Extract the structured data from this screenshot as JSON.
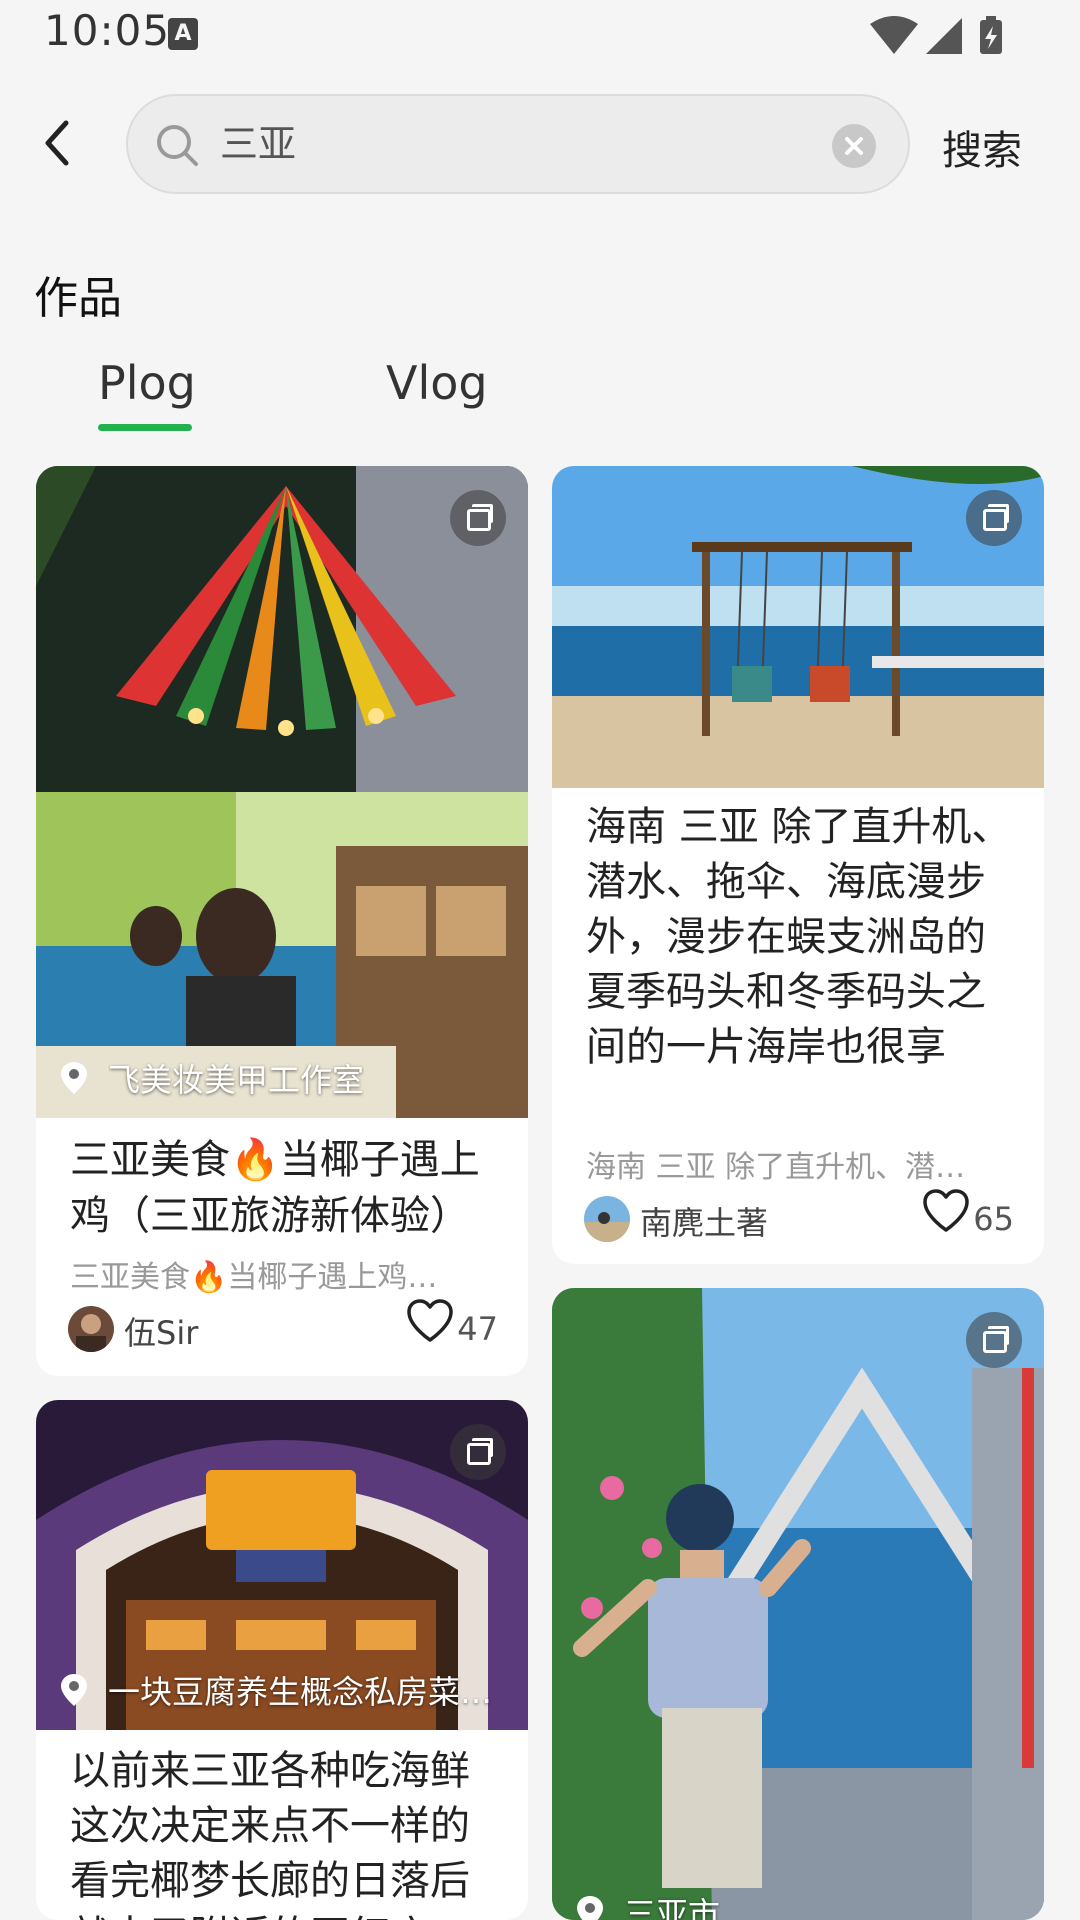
{
  "status": {
    "time": "10:05",
    "ime_badge": "A"
  },
  "search": {
    "query": "三亚",
    "button_label": "搜索"
  },
  "section": {
    "title": "作品"
  },
  "tabs": [
    {
      "label": "Plog",
      "selected": true
    },
    {
      "label": "Vlog",
      "selected": false
    }
  ],
  "cards": [
    {
      "location": "飞美妆美甲工作室",
      "title": "三亚美食🔥当椰子遇上鸡（三亚旅游新体验）",
      "subtitle": "三亚美食🔥当椰子遇上鸡…",
      "author": "伍Sir",
      "likes": "47"
    },
    {
      "title": "海南 三亚 除了直升机、潜水、拖伞、海底漫步外，漫步在蜈支洲岛的夏季码头和冬季码头之间的一片海岸也很享受，这里的沙滩像面",
      "subtitle": "海南 三亚 除了直升机、潜…",
      "author": "南麂土著",
      "likes": "65"
    },
    {
      "location": "一块豆腐养生概念私房菜…",
      "title": "以前来三亚各种吃海鲜这次决定来点不一样的看完椰梦长廊的日落后就去了附近的网红店"
    },
    {
      "location": "三亚市"
    }
  ],
  "colors": {
    "accent": "#22b14c",
    "background": "#f5f5f5"
  }
}
